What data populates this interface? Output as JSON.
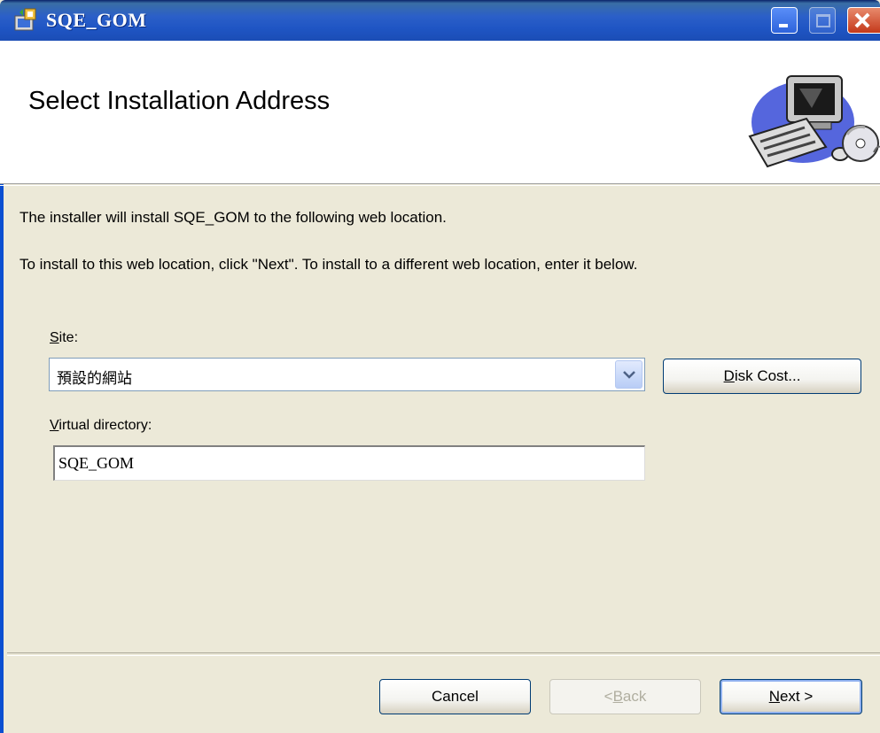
{
  "window": {
    "title": "SQE_GOM",
    "colors": {
      "titlebar": "#1f55c4",
      "background": "#ece9d8",
      "close": "#c4391b"
    }
  },
  "header": {
    "heading": "Select Installation Address",
    "image": "computer-and-cd-icon"
  },
  "body": {
    "line1": "The installer will install SQE_GOM to the following web location.",
    "line2": "To install to this web location, click \"Next\". To install to a different web location, enter it below."
  },
  "site": {
    "label_access": "S",
    "label_rest": "ite:",
    "value": "預設的網站",
    "disk_cost_access": "D",
    "disk_cost_rest": "isk Cost..."
  },
  "virtual_directory": {
    "label_access": "V",
    "label_rest": "irtual directory:",
    "value": "SQE_GOM"
  },
  "footer": {
    "cancel": "Cancel",
    "back_prefix": "< ",
    "back_access": "B",
    "back_rest": "ack",
    "next_access": "N",
    "next_rest": "ext >"
  }
}
